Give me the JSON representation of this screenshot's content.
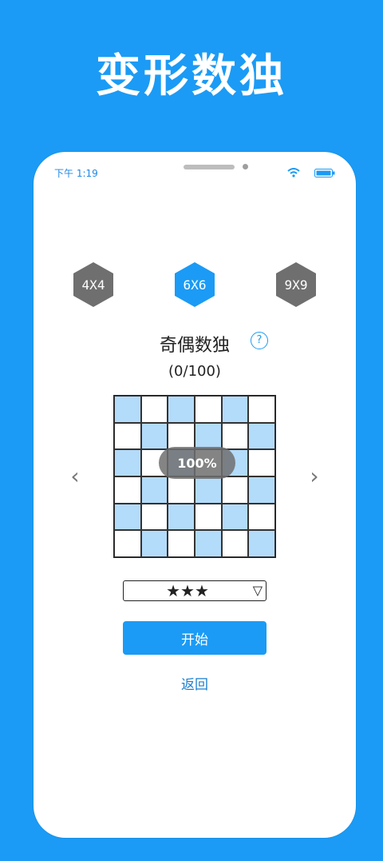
{
  "promo": {
    "title": "变形数独"
  },
  "status_bar": {
    "time": "下午 1:19"
  },
  "size_tabs": [
    {
      "label": "4X4",
      "selected": false
    },
    {
      "label": "6X6",
      "selected": true
    },
    {
      "label": "9X9",
      "selected": false
    }
  ],
  "puzzle": {
    "title": "奇偶数独",
    "help_symbol": "?",
    "progress": "(0/100)",
    "completion": "100%",
    "grid_size": 6,
    "shaded_cells": [
      [
        1,
        0,
        1,
        0,
        1,
        0
      ],
      [
        0,
        1,
        0,
        1,
        0,
        1
      ],
      [
        1,
        0,
        1,
        0,
        1,
        0
      ],
      [
        0,
        1,
        0,
        1,
        0,
        1
      ],
      [
        1,
        0,
        1,
        0,
        1,
        0
      ],
      [
        0,
        1,
        0,
        1,
        0,
        1
      ]
    ]
  },
  "navigation": {
    "prev": "‹",
    "next": "›"
  },
  "difficulty": {
    "value": "★★★",
    "rating": 3,
    "dropdown_symbol": "▽"
  },
  "actions": {
    "start": "开始",
    "back": "返回"
  },
  "colors": {
    "accent": "#1b9bf5",
    "shaded_cell": "#b3dbfa",
    "hex_inactive": "#6f6f6f"
  }
}
